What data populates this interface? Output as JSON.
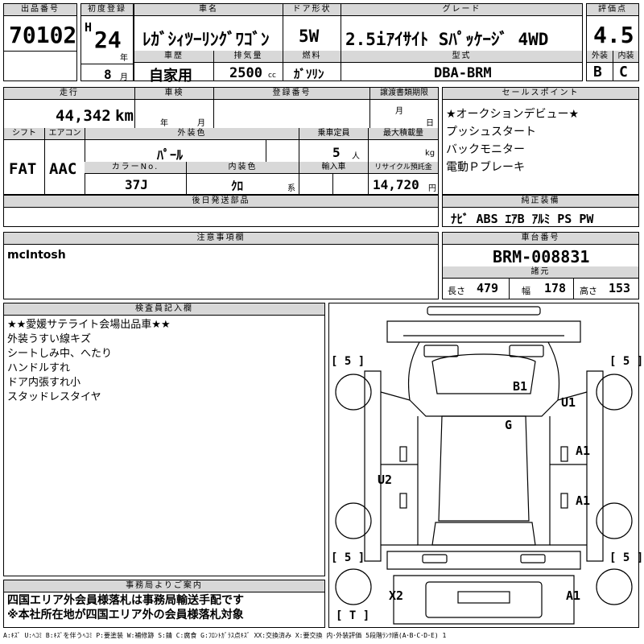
{
  "header_labels": {
    "lot_no": "出品番号",
    "first_reg": "初度登録",
    "car_name": "車名",
    "door": "ドア形状",
    "grade": "グレード",
    "score": "評価点",
    "history": "車歴",
    "displacement": "排気量",
    "fuel": "燃料",
    "model_code": "型式",
    "exterior": "外装",
    "interior": "内装"
  },
  "lot": {
    "number": "70102",
    "era": "H",
    "year": "24",
    "year_unit": "年",
    "month": "8",
    "month_unit": "月",
    "car_name": "ﾚｶﾞｼｨﾂｰﾘﾝｸﾞﾜｺﾞﾝ",
    "door": "5W",
    "grade": "2.5iｱｲｻｲﾄ Sﾊﾟｯｹｰｼﾞ 4WD",
    "score": "4.5",
    "history": "自家用",
    "displacement": "2500",
    "displacement_unit": "cc",
    "fuel": "ｶﾞｿﾘﾝ",
    "model_code": "DBA-BRM",
    "exterior_grade": "B",
    "interior_grade": "C"
  },
  "row2_labels": {
    "mileage": "走行",
    "inspection": "車検",
    "plate": "登録番号",
    "transfer": "譲渡書類期限",
    "sales": "セールスポイント",
    "shift": "シフト",
    "aircon": "エアコン",
    "ext_color": "外装色",
    "capacity": "乗車定員",
    "max_load": "最大積載量",
    "color_no": "カラーNo.",
    "int_color": "内装色",
    "import": "輸入車",
    "recycle": "リサイクル預託金",
    "later_parts": "後日発送部品",
    "equipment": "純正装備",
    "caution": "注意事項欄",
    "chassis": "車台番号",
    "dimensions": "諸元",
    "inspector": "検査員記入欄",
    "office": "事務局よりご案内"
  },
  "row2": {
    "mileage": "44,342",
    "mileage_unit": "km",
    "inspection_year_unit": "年",
    "inspection_month_unit": "月",
    "transfer_month_unit": "月",
    "transfer_day_unit": "日",
    "shift": "FAT",
    "aircon": "AAC",
    "ext_color": "ﾊﾟｰﾙ",
    "capacity": "5",
    "capacity_unit": "人",
    "load_unit": "kg",
    "color_no": "37J",
    "int_color": "ｸﾛ",
    "int_color_unit": "系",
    "recycle": "14,720",
    "recycle_unit": "円"
  },
  "sales_points": [
    "★オークションデビュー★",
    "プッシュスタート",
    "バックモニター",
    "電動Ｐブレーキ"
  ],
  "equipment": "ﾅﾋﾞ ABS ｴｱB ｱﾙﾐ PS PW",
  "caution_text": "mcIntosh",
  "chassis_no": "BRM-008831",
  "dims": {
    "length_label": "長さ",
    "length": "479",
    "width_label": "幅",
    "width": "178",
    "height_label": "高さ",
    "height": "153"
  },
  "inspector_notes": [
    "★★愛媛サテライト会場出品車★★",
    "外装うすい線キズ",
    "シートしみ中、へたり",
    "ハンドルすれ",
    "ドア内張すれ小",
    "スタッドレスタイヤ"
  ],
  "office_notes": [
    "四国エリア外会員様落札は事務局輸送手配です",
    "※本社所在地が四国エリア外の会員様落札対象"
  ],
  "diagram": {
    "marks": {
      "b1": "B1",
      "u1": "U1",
      "g": "G",
      "a1_upper": "A1",
      "u2": "U2",
      "a1_lower": "A1",
      "x2": "X2",
      "a1_rear": "A1"
    },
    "tire_fl": "[ 5 ]",
    "tire_fr": "[ 5 ]",
    "tire_rl": "[ 5 ]",
    "tire_rr": "[ 5 ]",
    "tire_t": "[ T ]"
  },
  "legend": "A:ｷｽﾞ U:ﾍｺﾐ B:ｷｽﾞを伴うﾍｺﾐ P:要塗装 W:補修跡 S:錆 C:腐食 G:ﾌﾛﾝﾄｶﾞﾗｽ点ｷｽﾞ XX:交換済み X:要交換 内･外装評価 5段階ﾗﾝｸ順(A･B･C･D･E) 1"
}
